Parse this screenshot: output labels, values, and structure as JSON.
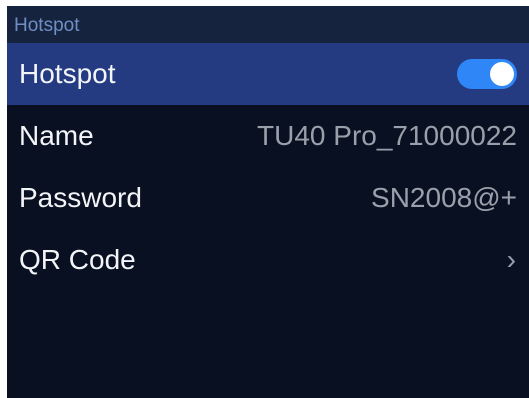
{
  "header": {
    "title": "Hotspot"
  },
  "rows": [
    {
      "label": "Hotspot",
      "toggle_on": true
    },
    {
      "label": "Name",
      "value": "TU40 Pro_71000022"
    },
    {
      "label": "Password",
      "value": "SN2008@+"
    },
    {
      "label": "QR Code",
      "chevron": "›"
    }
  ],
  "colors": {
    "screen_background": "#081022",
    "header_background": "#15233f",
    "header_text": "#6f8fc4",
    "selected_row": "#243b82",
    "toggle_on": "#2f86f6"
  },
  "icons": {
    "toggle": "toggle-switch-icon",
    "qr_code_arrow": "chevron-right-icon"
  }
}
